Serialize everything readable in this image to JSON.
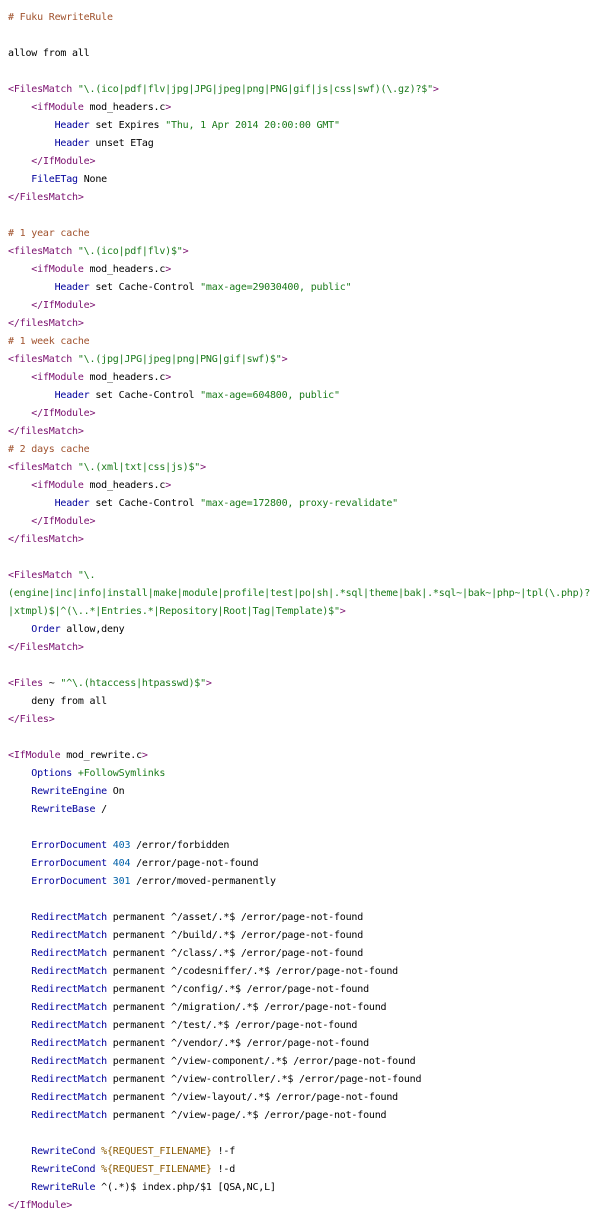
{
  "code": {
    "lines": [
      [
        {
          "t": "comment",
          "v": "# Fuku RewriteRule"
        }
      ],
      [],
      [
        {
          "t": "plain",
          "v": "allow from all"
        }
      ],
      [],
      [
        {
          "t": "tag",
          "v": "<FilesMatch "
        },
        {
          "t": "string",
          "v": "\"\\.(ico|pdf|flv|jpg|JPG|jpeg|png|PNG|gif|js|css|swf)(\\.gz)?$\""
        },
        {
          "t": "tag",
          "v": ">"
        }
      ],
      [
        {
          "t": "plain",
          "v": "    "
        },
        {
          "t": "tag",
          "v": "<ifModule "
        },
        {
          "t": "plain",
          "v": "mod_headers.c"
        },
        {
          "t": "tag",
          "v": ">"
        }
      ],
      [
        {
          "t": "plain",
          "v": "        "
        },
        {
          "t": "directive",
          "v": "Header"
        },
        {
          "t": "plain",
          "v": " set Expires "
        },
        {
          "t": "string",
          "v": "\"Thu, 1 Apr 2014 20:00:00 GMT\""
        }
      ],
      [
        {
          "t": "plain",
          "v": "        "
        },
        {
          "t": "directive",
          "v": "Header"
        },
        {
          "t": "plain",
          "v": " unset ETag"
        }
      ],
      [
        {
          "t": "plain",
          "v": "    "
        },
        {
          "t": "tag",
          "v": "</IfModule>"
        }
      ],
      [
        {
          "t": "plain",
          "v": "    "
        },
        {
          "t": "directive",
          "v": "FileETag"
        },
        {
          "t": "plain",
          "v": " None"
        }
      ],
      [
        {
          "t": "tag",
          "v": "</FilesMatch>"
        }
      ],
      [],
      [
        {
          "t": "comment",
          "v": "# 1 year cache"
        }
      ],
      [
        {
          "t": "tag",
          "v": "<filesMatch "
        },
        {
          "t": "string",
          "v": "\"\\.(ico|pdf|flv)$\""
        },
        {
          "t": "tag",
          "v": ">"
        }
      ],
      [
        {
          "t": "plain",
          "v": "    "
        },
        {
          "t": "tag",
          "v": "<ifModule "
        },
        {
          "t": "plain",
          "v": "mod_headers.c"
        },
        {
          "t": "tag",
          "v": ">"
        }
      ],
      [
        {
          "t": "plain",
          "v": "        "
        },
        {
          "t": "directive",
          "v": "Header"
        },
        {
          "t": "plain",
          "v": " set Cache-Control "
        },
        {
          "t": "string",
          "v": "\"max-age=29030400, public\""
        }
      ],
      [
        {
          "t": "plain",
          "v": "    "
        },
        {
          "t": "tag",
          "v": "</IfModule>"
        }
      ],
      [
        {
          "t": "tag",
          "v": "</filesMatch>"
        }
      ],
      [
        {
          "t": "comment",
          "v": "# 1 week cache"
        }
      ],
      [
        {
          "t": "tag",
          "v": "<filesMatch "
        },
        {
          "t": "string",
          "v": "\"\\.(jpg|JPG|jpeg|png|PNG|gif|swf)$\""
        },
        {
          "t": "tag",
          "v": ">"
        }
      ],
      [
        {
          "t": "plain",
          "v": "    "
        },
        {
          "t": "tag",
          "v": "<ifModule "
        },
        {
          "t": "plain",
          "v": "mod_headers.c"
        },
        {
          "t": "tag",
          "v": ">"
        }
      ],
      [
        {
          "t": "plain",
          "v": "        "
        },
        {
          "t": "directive",
          "v": "Header"
        },
        {
          "t": "plain",
          "v": " set Cache-Control "
        },
        {
          "t": "string",
          "v": "\"max-age=604800, public\""
        }
      ],
      [
        {
          "t": "plain",
          "v": "    "
        },
        {
          "t": "tag",
          "v": "</IfModule>"
        }
      ],
      [
        {
          "t": "tag",
          "v": "</filesMatch>"
        }
      ],
      [
        {
          "t": "comment",
          "v": "# 2 days cache"
        }
      ],
      [
        {
          "t": "tag",
          "v": "<filesMatch "
        },
        {
          "t": "string",
          "v": "\"\\.(xml|txt|css|js)$\""
        },
        {
          "t": "tag",
          "v": ">"
        }
      ],
      [
        {
          "t": "plain",
          "v": "    "
        },
        {
          "t": "tag",
          "v": "<ifModule "
        },
        {
          "t": "plain",
          "v": "mod_headers.c"
        },
        {
          "t": "tag",
          "v": ">"
        }
      ],
      [
        {
          "t": "plain",
          "v": "        "
        },
        {
          "t": "directive",
          "v": "Header"
        },
        {
          "t": "plain",
          "v": " set Cache-Control "
        },
        {
          "t": "string",
          "v": "\"max-age=172800, proxy-revalidate\""
        }
      ],
      [
        {
          "t": "plain",
          "v": "    "
        },
        {
          "t": "tag",
          "v": "</IfModule>"
        }
      ],
      [
        {
          "t": "tag",
          "v": "</filesMatch>"
        }
      ],
      [],
      [
        {
          "t": "tag",
          "v": "<FilesMatch "
        },
        {
          "t": "string",
          "v": "\"\\."
        }
      ],
      [
        {
          "t": "string",
          "v": "(engine|inc|info|install|make|module|profile|test|po|sh|.*sql|theme|bak|.*sql~|bak~|php~|tpl(\\.php)?"
        }
      ],
      [
        {
          "t": "string",
          "v": "|xtmpl)$|^(\\..*|Entries.*|Repository|Root|Tag|Template)$\""
        },
        {
          "t": "tag",
          "v": ">"
        }
      ],
      [
        {
          "t": "plain",
          "v": "    "
        },
        {
          "t": "directive",
          "v": "Order"
        },
        {
          "t": "plain",
          "v": " allow,deny"
        }
      ],
      [
        {
          "t": "tag",
          "v": "</FilesMatch>"
        }
      ],
      [],
      [
        {
          "t": "tag",
          "v": "<Files "
        },
        {
          "t": "plain",
          "v": "~ "
        },
        {
          "t": "string",
          "v": "\"^\\.(htaccess|htpasswd)$\""
        },
        {
          "t": "tag",
          "v": ">"
        }
      ],
      [
        {
          "t": "plain",
          "v": "    deny from all"
        }
      ],
      [
        {
          "t": "tag",
          "v": "</Files>"
        }
      ],
      [],
      [
        {
          "t": "tag",
          "v": "<IfModule "
        },
        {
          "t": "plain",
          "v": "mod_rewrite.c"
        },
        {
          "t": "tag",
          "v": ">"
        }
      ],
      [
        {
          "t": "plain",
          "v": "    "
        },
        {
          "t": "directive",
          "v": "Options"
        },
        {
          "t": "plain",
          "v": " "
        },
        {
          "t": "string",
          "v": "+FollowSymlinks"
        }
      ],
      [
        {
          "t": "plain",
          "v": "    "
        },
        {
          "t": "directive",
          "v": "RewriteEngine"
        },
        {
          "t": "plain",
          "v": " On"
        }
      ],
      [
        {
          "t": "plain",
          "v": "    "
        },
        {
          "t": "directive",
          "v": "RewriteBase"
        },
        {
          "t": "plain",
          "v": " /"
        }
      ],
      [],
      [
        {
          "t": "plain",
          "v": "    "
        },
        {
          "t": "directive",
          "v": "ErrorDocument"
        },
        {
          "t": "plain",
          "v": " "
        },
        {
          "t": "number",
          "v": "403"
        },
        {
          "t": "plain",
          "v": " /error/forbidden"
        }
      ],
      [
        {
          "t": "plain",
          "v": "    "
        },
        {
          "t": "directive",
          "v": "ErrorDocument"
        },
        {
          "t": "plain",
          "v": " "
        },
        {
          "t": "number",
          "v": "404"
        },
        {
          "t": "plain",
          "v": " /error/page-not-found"
        }
      ],
      [
        {
          "t": "plain",
          "v": "    "
        },
        {
          "t": "directive",
          "v": "ErrorDocument"
        },
        {
          "t": "plain",
          "v": " "
        },
        {
          "t": "number",
          "v": "301"
        },
        {
          "t": "plain",
          "v": " /error/moved-permanently"
        }
      ],
      [],
      [
        {
          "t": "plain",
          "v": "    "
        },
        {
          "t": "directive",
          "v": "RedirectMatch"
        },
        {
          "t": "plain",
          "v": " permanent ^/asset/.*$ /error/page-not-found"
        }
      ],
      [
        {
          "t": "plain",
          "v": "    "
        },
        {
          "t": "directive",
          "v": "RedirectMatch"
        },
        {
          "t": "plain",
          "v": " permanent ^/build/.*$ /error/page-not-found"
        }
      ],
      [
        {
          "t": "plain",
          "v": "    "
        },
        {
          "t": "directive",
          "v": "RedirectMatch"
        },
        {
          "t": "plain",
          "v": " permanent ^/class/.*$ /error/page-not-found"
        }
      ],
      [
        {
          "t": "plain",
          "v": "    "
        },
        {
          "t": "directive",
          "v": "RedirectMatch"
        },
        {
          "t": "plain",
          "v": " permanent ^/codesniffer/.*$ /error/page-not-found"
        }
      ],
      [
        {
          "t": "plain",
          "v": "    "
        },
        {
          "t": "directive",
          "v": "RedirectMatch"
        },
        {
          "t": "plain",
          "v": " permanent ^/config/.*$ /error/page-not-found"
        }
      ],
      [
        {
          "t": "plain",
          "v": "    "
        },
        {
          "t": "directive",
          "v": "RedirectMatch"
        },
        {
          "t": "plain",
          "v": " permanent ^/migration/.*$ /error/page-not-found"
        }
      ],
      [
        {
          "t": "plain",
          "v": "    "
        },
        {
          "t": "directive",
          "v": "RedirectMatch"
        },
        {
          "t": "plain",
          "v": " permanent ^/test/.*$ /error/page-not-found"
        }
      ],
      [
        {
          "t": "plain",
          "v": "    "
        },
        {
          "t": "directive",
          "v": "RedirectMatch"
        },
        {
          "t": "plain",
          "v": " permanent ^/vendor/.*$ /error/page-not-found"
        }
      ],
      [
        {
          "t": "plain",
          "v": "    "
        },
        {
          "t": "directive",
          "v": "RedirectMatch"
        },
        {
          "t": "plain",
          "v": " permanent ^/view-component/.*$ /error/page-not-found"
        }
      ],
      [
        {
          "t": "plain",
          "v": "    "
        },
        {
          "t": "directive",
          "v": "RedirectMatch"
        },
        {
          "t": "plain",
          "v": " permanent ^/view-controller/.*$ /error/page-not-found"
        }
      ],
      [
        {
          "t": "plain",
          "v": "    "
        },
        {
          "t": "directive",
          "v": "RedirectMatch"
        },
        {
          "t": "plain",
          "v": " permanent ^/view-layout/.*$ /error/page-not-found"
        }
      ],
      [
        {
          "t": "plain",
          "v": "    "
        },
        {
          "t": "directive",
          "v": "RedirectMatch"
        },
        {
          "t": "plain",
          "v": " permanent ^/view-page/.*$ /error/page-not-found"
        }
      ],
      [],
      [
        {
          "t": "plain",
          "v": "    "
        },
        {
          "t": "directive",
          "v": "RewriteCond"
        },
        {
          "t": "plain",
          "v": " "
        },
        {
          "t": "var",
          "v": "%{REQUEST_FILENAME}"
        },
        {
          "t": "plain",
          "v": " !-f"
        }
      ],
      [
        {
          "t": "plain",
          "v": "    "
        },
        {
          "t": "directive",
          "v": "RewriteCond"
        },
        {
          "t": "plain",
          "v": " "
        },
        {
          "t": "var",
          "v": "%{REQUEST_FILENAME}"
        },
        {
          "t": "plain",
          "v": " !-d"
        }
      ],
      [
        {
          "t": "plain",
          "v": "    "
        },
        {
          "t": "directive",
          "v": "RewriteRule"
        },
        {
          "t": "plain",
          "v": " ^(.*)$ index.php/$1 [QSA,NC,L]"
        }
      ],
      [
        {
          "t": "tag",
          "v": "</IfModule>"
        }
      ]
    ]
  }
}
